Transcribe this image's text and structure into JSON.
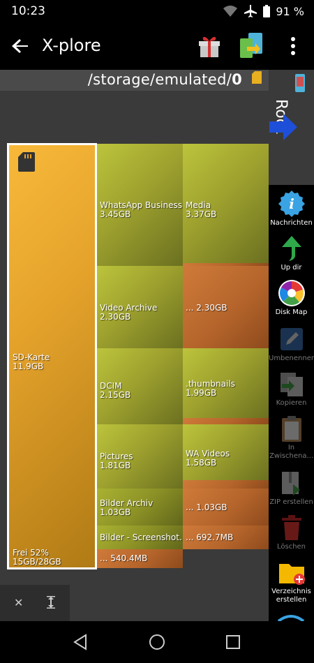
{
  "status": {
    "time": "10:23",
    "battery": "91 %"
  },
  "app": {
    "title": "X-plore"
  },
  "path": {
    "prefix": "/storage/emulated/",
    "last": "0"
  },
  "root_tab": {
    "label": "Root"
  },
  "sd_card": {
    "name": "SD-Karte",
    "size": "11.9GB",
    "free_label": "Frei 52%",
    "free_detail": "15GB/28GB"
  },
  "blocks": [
    {
      "name": "WhatsApp Business...",
      "size": "3.45GB"
    },
    {
      "name": "Media",
      "size": "3.37GB"
    },
    {
      "name": "Video Archive",
      "size": "2.30GB"
    },
    {
      "name": "...",
      "size": "2.30GB"
    },
    {
      "name": "DCIM",
      "size": "2.15GB"
    },
    {
      "name": ".thumbnails",
      "size": "1.99GB"
    },
    {
      "name": "Pictures",
      "size": "1.81GB"
    },
    {
      "name": "WA Videos",
      "size": "1.58GB"
    },
    {
      "name": "Bilder Archiv",
      "size": "1.03GB"
    },
    {
      "name": "...",
      "size": "1.03GB"
    },
    {
      "name": "Bilder - Screenshot...",
      "size": ""
    },
    {
      "name": "...",
      "size": "692.7MB"
    },
    {
      "name": "...",
      "size": "540.4MB"
    }
  ],
  "toolbar": [
    {
      "label": "Nachrichten",
      "icon": "info-icon",
      "enabled": true
    },
    {
      "label": "Up dir",
      "icon": "up-arrow-icon",
      "enabled": true
    },
    {
      "label": "Disk Map",
      "icon": "disk-map-icon",
      "enabled": true
    },
    {
      "label": "Umbenennen",
      "icon": "rename-icon",
      "enabled": false
    },
    {
      "label": "Kopieren",
      "icon": "copy-icon",
      "enabled": false
    },
    {
      "label": "In Zwischena...",
      "icon": "clipboard-icon",
      "enabled": false
    },
    {
      "label": "ZIP erstellen",
      "icon": "zip-icon",
      "enabled": false
    },
    {
      "label": "Löschen",
      "icon": "trash-icon",
      "enabled": false
    },
    {
      "label": "Verzeichnis erstellen",
      "icon": "new-folder-icon",
      "enabled": true
    }
  ]
}
